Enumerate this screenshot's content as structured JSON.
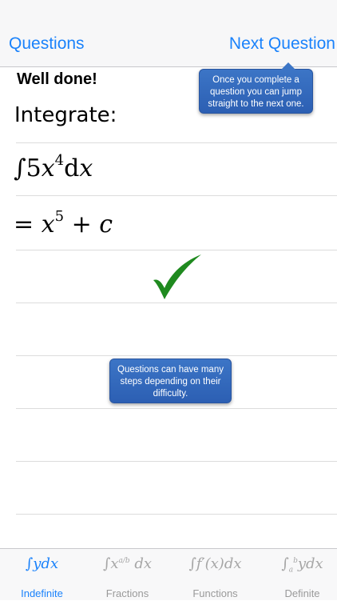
{
  "nav": {
    "back_label": "Questions",
    "next_label": "Next Question"
  },
  "status_text": "Well done!",
  "tooltips": {
    "next_tip": "Once you complete a question you can jump straight to the next one.",
    "steps_tip": "Questions can have many steps depending on their difficulty."
  },
  "question": {
    "prompt": "Integrate:",
    "integrand_coeff": "5",
    "integrand_var": "x",
    "integrand_power": "4",
    "answer_var": "x",
    "answer_power": "5",
    "answer_const": "c"
  },
  "result": {
    "icon": "checkmark-icon",
    "color": "#1f8a1f"
  },
  "tabs": [
    {
      "label": "Indefinite",
      "icon_text": "∫ydx",
      "active": true
    },
    {
      "label": "Fractions",
      "icon_text": "∫x^(a/b) dx",
      "active": false
    },
    {
      "label": "Functions",
      "icon_text": "∫f′(x)dx",
      "active": false
    },
    {
      "label": "Definite",
      "icon_text": "∫ₐᵇydx",
      "active": false
    }
  ],
  "colors": {
    "accent": "#1a82fb",
    "tooltip": "#3168bd"
  }
}
